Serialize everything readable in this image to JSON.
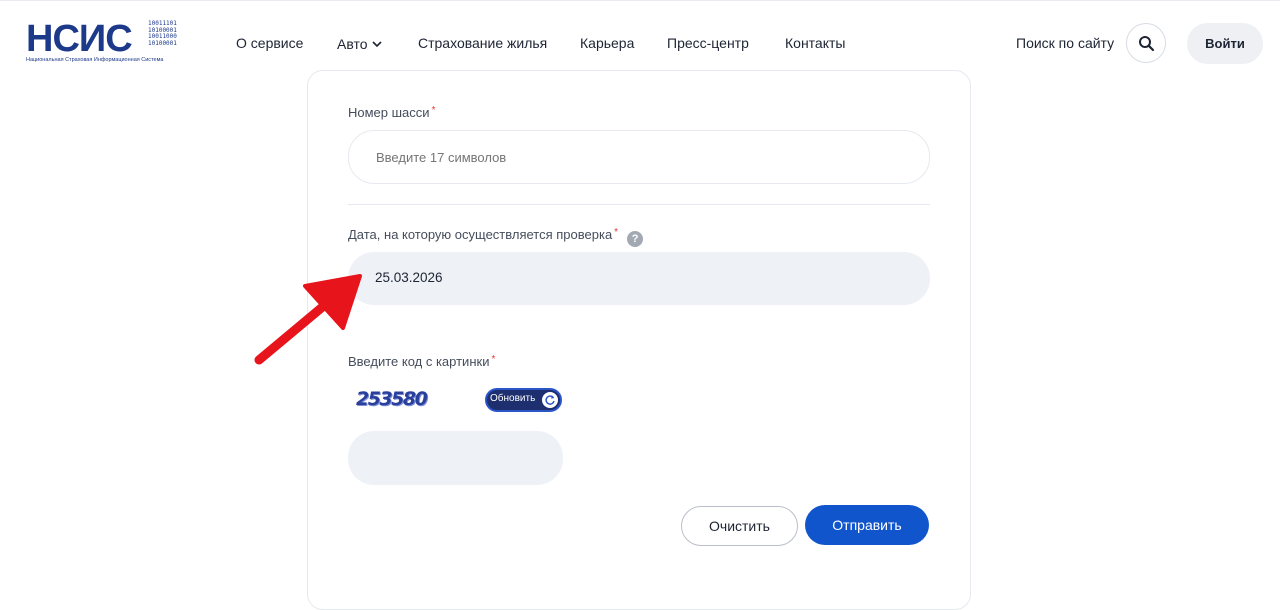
{
  "header": {
    "logo": {
      "main": "НСИС",
      "bits": "10011101\n10100001\n10011000\n10100001",
      "subtitle": "Национальная Страховая Информационная Система"
    },
    "nav": [
      {
        "label": "О сервисе"
      },
      {
        "label": "Авто",
        "has_dropdown": true
      },
      {
        "label": "Страхование жилья"
      },
      {
        "label": "Карьера"
      },
      {
        "label": "Пресс-центр"
      },
      {
        "label": "Контакты"
      }
    ],
    "search_label": "Поиск по сайту",
    "login_label": "Войти"
  },
  "form": {
    "chassis": {
      "label": "Номер шасси",
      "required_mark": "*",
      "placeholder": "Введите 17 символов",
      "value": ""
    },
    "check_date": {
      "label": "Дата, на которую осуществляется проверка",
      "required_mark": "*",
      "help_icon": "?",
      "value": "25.03.2026"
    },
    "captcha": {
      "label": "Введите код с картинки",
      "required_mark": "*",
      "image_text": "253580",
      "refresh_label": "Обновить",
      "value": ""
    },
    "clear_label": "Очистить",
    "submit_label": "Отправить"
  },
  "colors": {
    "brand": "#1d3a8a",
    "primary_button": "#1155cc",
    "required": "#e53935",
    "annotation_arrow": "#e8141c"
  }
}
